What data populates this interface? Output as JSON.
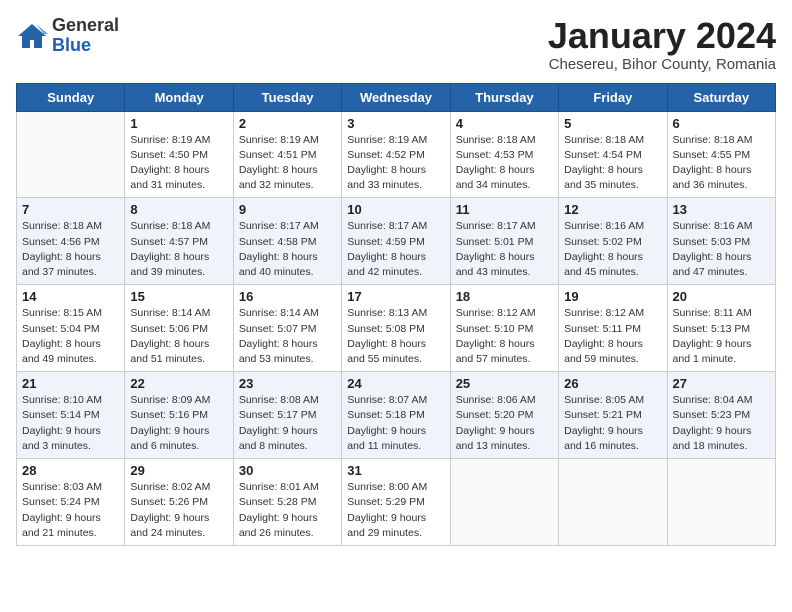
{
  "logo": {
    "general": "General",
    "blue": "Blue"
  },
  "title": "January 2024",
  "subtitle": "Chesereu, Bihor County, Romania",
  "weekdays": [
    "Sunday",
    "Monday",
    "Tuesday",
    "Wednesday",
    "Thursday",
    "Friday",
    "Saturday"
  ],
  "weeks": [
    [
      {
        "day": "",
        "sunrise": "",
        "sunset": "",
        "daylight": ""
      },
      {
        "day": "1",
        "sunrise": "Sunrise: 8:19 AM",
        "sunset": "Sunset: 4:50 PM",
        "daylight": "Daylight: 8 hours and 31 minutes."
      },
      {
        "day": "2",
        "sunrise": "Sunrise: 8:19 AM",
        "sunset": "Sunset: 4:51 PM",
        "daylight": "Daylight: 8 hours and 32 minutes."
      },
      {
        "day": "3",
        "sunrise": "Sunrise: 8:19 AM",
        "sunset": "Sunset: 4:52 PM",
        "daylight": "Daylight: 8 hours and 33 minutes."
      },
      {
        "day": "4",
        "sunrise": "Sunrise: 8:18 AM",
        "sunset": "Sunset: 4:53 PM",
        "daylight": "Daylight: 8 hours and 34 minutes."
      },
      {
        "day": "5",
        "sunrise": "Sunrise: 8:18 AM",
        "sunset": "Sunset: 4:54 PM",
        "daylight": "Daylight: 8 hours and 35 minutes."
      },
      {
        "day": "6",
        "sunrise": "Sunrise: 8:18 AM",
        "sunset": "Sunset: 4:55 PM",
        "daylight": "Daylight: 8 hours and 36 minutes."
      }
    ],
    [
      {
        "day": "7",
        "sunrise": "Sunrise: 8:18 AM",
        "sunset": "Sunset: 4:56 PM",
        "daylight": "Daylight: 8 hours and 37 minutes."
      },
      {
        "day": "8",
        "sunrise": "Sunrise: 8:18 AM",
        "sunset": "Sunset: 4:57 PM",
        "daylight": "Daylight: 8 hours and 39 minutes."
      },
      {
        "day": "9",
        "sunrise": "Sunrise: 8:17 AM",
        "sunset": "Sunset: 4:58 PM",
        "daylight": "Daylight: 8 hours and 40 minutes."
      },
      {
        "day": "10",
        "sunrise": "Sunrise: 8:17 AM",
        "sunset": "Sunset: 4:59 PM",
        "daylight": "Daylight: 8 hours and 42 minutes."
      },
      {
        "day": "11",
        "sunrise": "Sunrise: 8:17 AM",
        "sunset": "Sunset: 5:01 PM",
        "daylight": "Daylight: 8 hours and 43 minutes."
      },
      {
        "day": "12",
        "sunrise": "Sunrise: 8:16 AM",
        "sunset": "Sunset: 5:02 PM",
        "daylight": "Daylight: 8 hours and 45 minutes."
      },
      {
        "day": "13",
        "sunrise": "Sunrise: 8:16 AM",
        "sunset": "Sunset: 5:03 PM",
        "daylight": "Daylight: 8 hours and 47 minutes."
      }
    ],
    [
      {
        "day": "14",
        "sunrise": "Sunrise: 8:15 AM",
        "sunset": "Sunset: 5:04 PM",
        "daylight": "Daylight: 8 hours and 49 minutes."
      },
      {
        "day": "15",
        "sunrise": "Sunrise: 8:14 AM",
        "sunset": "Sunset: 5:06 PM",
        "daylight": "Daylight: 8 hours and 51 minutes."
      },
      {
        "day": "16",
        "sunrise": "Sunrise: 8:14 AM",
        "sunset": "Sunset: 5:07 PM",
        "daylight": "Daylight: 8 hours and 53 minutes."
      },
      {
        "day": "17",
        "sunrise": "Sunrise: 8:13 AM",
        "sunset": "Sunset: 5:08 PM",
        "daylight": "Daylight: 8 hours and 55 minutes."
      },
      {
        "day": "18",
        "sunrise": "Sunrise: 8:12 AM",
        "sunset": "Sunset: 5:10 PM",
        "daylight": "Daylight: 8 hours and 57 minutes."
      },
      {
        "day": "19",
        "sunrise": "Sunrise: 8:12 AM",
        "sunset": "Sunset: 5:11 PM",
        "daylight": "Daylight: 8 hours and 59 minutes."
      },
      {
        "day": "20",
        "sunrise": "Sunrise: 8:11 AM",
        "sunset": "Sunset: 5:13 PM",
        "daylight": "Daylight: 9 hours and 1 minute."
      }
    ],
    [
      {
        "day": "21",
        "sunrise": "Sunrise: 8:10 AM",
        "sunset": "Sunset: 5:14 PM",
        "daylight": "Daylight: 9 hours and 3 minutes."
      },
      {
        "day": "22",
        "sunrise": "Sunrise: 8:09 AM",
        "sunset": "Sunset: 5:16 PM",
        "daylight": "Daylight: 9 hours and 6 minutes."
      },
      {
        "day": "23",
        "sunrise": "Sunrise: 8:08 AM",
        "sunset": "Sunset: 5:17 PM",
        "daylight": "Daylight: 9 hours and 8 minutes."
      },
      {
        "day": "24",
        "sunrise": "Sunrise: 8:07 AM",
        "sunset": "Sunset: 5:18 PM",
        "daylight": "Daylight: 9 hours and 11 minutes."
      },
      {
        "day": "25",
        "sunrise": "Sunrise: 8:06 AM",
        "sunset": "Sunset: 5:20 PM",
        "daylight": "Daylight: 9 hours and 13 minutes."
      },
      {
        "day": "26",
        "sunrise": "Sunrise: 8:05 AM",
        "sunset": "Sunset: 5:21 PM",
        "daylight": "Daylight: 9 hours and 16 minutes."
      },
      {
        "day": "27",
        "sunrise": "Sunrise: 8:04 AM",
        "sunset": "Sunset: 5:23 PM",
        "daylight": "Daylight: 9 hours and 18 minutes."
      }
    ],
    [
      {
        "day": "28",
        "sunrise": "Sunrise: 8:03 AM",
        "sunset": "Sunset: 5:24 PM",
        "daylight": "Daylight: 9 hours and 21 minutes."
      },
      {
        "day": "29",
        "sunrise": "Sunrise: 8:02 AM",
        "sunset": "Sunset: 5:26 PM",
        "daylight": "Daylight: 9 hours and 24 minutes."
      },
      {
        "day": "30",
        "sunrise": "Sunrise: 8:01 AM",
        "sunset": "Sunset: 5:28 PM",
        "daylight": "Daylight: 9 hours and 26 minutes."
      },
      {
        "day": "31",
        "sunrise": "Sunrise: 8:00 AM",
        "sunset": "Sunset: 5:29 PM",
        "daylight": "Daylight: 9 hours and 29 minutes."
      },
      {
        "day": "",
        "sunrise": "",
        "sunset": "",
        "daylight": ""
      },
      {
        "day": "",
        "sunrise": "",
        "sunset": "",
        "daylight": ""
      },
      {
        "day": "",
        "sunrise": "",
        "sunset": "",
        "daylight": ""
      }
    ]
  ]
}
